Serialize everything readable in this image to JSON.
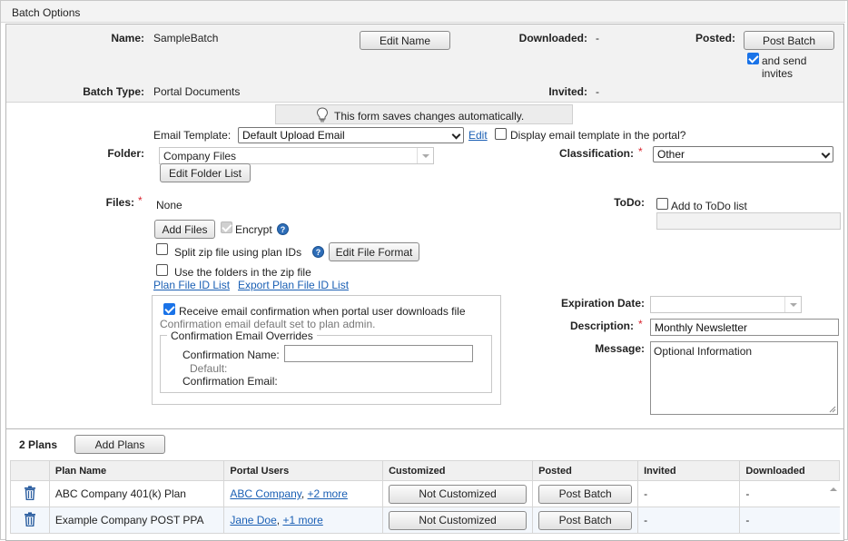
{
  "panel_title": "Batch Options",
  "header": {
    "name_label": "Name:",
    "name_value": "SampleBatch",
    "edit_name_button": "Edit Name",
    "downloaded_label": "Downloaded:",
    "downloaded_value": "-",
    "posted_label": "Posted:",
    "post_batch_button": "Post Batch",
    "send_invites_label": "and send invites",
    "send_invites_checked": true,
    "batch_type_label": "Batch Type:",
    "batch_type_value": "Portal Documents",
    "invited_label": "Invited:",
    "invited_value": "-"
  },
  "autosave_notice": "This form saves changes automatically.",
  "email_template": {
    "label": "Email Template:",
    "value": "Default Upload Email",
    "edit_link": "Edit",
    "display_in_portal_label": "Display email template in the portal?",
    "display_in_portal_checked": false
  },
  "folder": {
    "label": "Folder:",
    "value": "Company Files",
    "edit_button": "Edit Folder List"
  },
  "classification": {
    "label": "Classification:",
    "value": "Other"
  },
  "files": {
    "label": "Files:",
    "value": "None",
    "add_button": "Add Files",
    "encrypt_label": "Encrypt",
    "encrypt_checked": true,
    "split_zip_label": "Split zip file using plan IDs",
    "split_zip_checked": false,
    "edit_file_format_button": "Edit File Format",
    "use_folders_label": "Use the folders in the zip file",
    "use_folders_checked": false,
    "plan_file_id_link": "Plan File ID List",
    "export_plan_file_id_link": "Export Plan File ID List"
  },
  "todo": {
    "label": "ToDo:",
    "add_label": "Add to ToDo list",
    "add_checked": false,
    "value": ""
  },
  "confirmation": {
    "receive_label": "Receive email confirmation when portal user downloads file",
    "receive_checked": true,
    "default_note": "Confirmation email default set to plan admin.",
    "overrides_legend": "Confirmation Email Overrides",
    "name_label": "Confirmation Name:",
    "name_value": "",
    "default_label": "Default:",
    "email_label": "Confirmation Email:"
  },
  "expiration": {
    "label": "Expiration Date:",
    "value": ""
  },
  "description": {
    "label": "Description:",
    "value": "Monthly Newsletter"
  },
  "message": {
    "label": "Message:",
    "value": "Optional Information"
  },
  "plans": {
    "count_label": "2 Plans",
    "add_button": "Add Plans",
    "columns": [
      "Plan Name",
      "Portal Users",
      "Customized",
      "Posted",
      "Invited",
      "Downloaded"
    ],
    "rows": [
      {
        "plan_name": "ABC Company 401(k) Plan",
        "portal_user": "ABC Company",
        "more_users": "+2 more",
        "customized": "Not Customized",
        "posted": "Post Batch",
        "invited": "-",
        "downloaded": "-"
      },
      {
        "plan_name": "Example Company POST PPA",
        "portal_user": "Jane Doe",
        "more_users": "+1 more",
        "customized": "Not Customized",
        "posted": "Post Batch",
        "invited": "-",
        "downloaded": "-"
      }
    ]
  },
  "colors": {
    "link": "#1a5fb4",
    "required": "#d9232d",
    "checkbox": "#1a73e8",
    "header_bg": "#f2f2f2"
  },
  "icons": [
    "lightbulb-icon",
    "help-icon",
    "trash-icon",
    "scroll-up-icon"
  ]
}
